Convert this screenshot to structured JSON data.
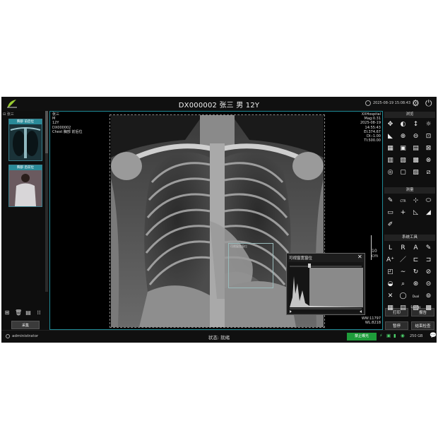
{
  "header": {
    "title": "DX000002  张三  男  12Y",
    "datetime": "2025-08-19 15:08:43"
  },
  "left_panel": {
    "tree_label": "张三",
    "thumbnails": [
      {
        "label": "胸部 前后位"
      },
      {
        "label": "胸部 后前位"
      }
    ],
    "collect_label": "采集"
  },
  "viewer": {
    "patient_info": [
      "张三",
      "M",
      "12Y",
      "DX000002",
      "Chest 胸部 前后位"
    ],
    "hospital_info": [
      "XXHospital",
      "Mag:0.31",
      "2025-08-19",
      "14:55:43",
      "EI:374.67",
      "DI:-1.00",
      "TI:500.00"
    ],
    "ruler_label": "10\ncm",
    "ww": "WW:11797",
    "wl": "WL:8218",
    "roi_label": "可视窗宽窗位",
    "histogram": {
      "title": "可视窗宽窗位",
      "close": "✕"
    }
  },
  "right_panel": {
    "sections": [
      "浏览",
      "测量",
      "系统工具"
    ],
    "browse_tools": [
      "✥",
      "◐",
      "↕",
      "☼",
      "◣",
      "⊕",
      "⊖",
      "⊡",
      "▦",
      "▣",
      "▤",
      "⊠",
      "▥",
      "▧",
      "▩",
      "⊗",
      "◎",
      "▢",
      "▨",
      "⧄"
    ],
    "measure_tools": [
      "✎",
      "CTR",
      "⊹",
      "⬭",
      "▭",
      "+",
      "◺",
      "◢",
      "✐"
    ],
    "system_tools": [
      "L",
      "R",
      "A",
      "✎",
      "A⁺",
      "／",
      "⊏",
      "⊐",
      "◰",
      "∼",
      "↻",
      "⊘",
      "◒",
      "⌕",
      "⊛",
      "⊝",
      "✕",
      "◯",
      "Dual\nEnergy",
      "⊚",
      "▦",
      "▤",
      "▧",
      "▩"
    ],
    "buttons": {
      "print": "打印",
      "report": "报告",
      "pause": "暂停",
      "finish": "结束检查"
    }
  },
  "status_bar": {
    "username": "administrator",
    "state": "状态: 就绪",
    "exposure": "禁止曝光",
    "disk": "250 GB"
  },
  "colors": {
    "accent": "#1f8a96",
    "exposure": "#1e9c3a",
    "background": "#0c0c0c"
  }
}
